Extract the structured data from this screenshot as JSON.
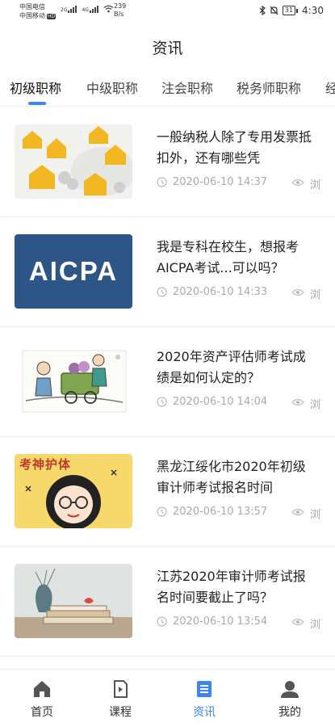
{
  "status_bar": {
    "carrier_1": "中国电信",
    "carrier_2": "中国移动",
    "hd_badge": "HD",
    "net_1": "2G",
    "net_2": "4G",
    "speed_value": "239",
    "speed_unit": "B/s",
    "battery": "31",
    "time": "4:30"
  },
  "header": {
    "title": "资讯"
  },
  "tabs": [
    {
      "label": "初级职称",
      "active": true
    },
    {
      "label": "中级职称"
    },
    {
      "label": "注会职称"
    },
    {
      "label": "税务师职称"
    },
    {
      "label": "经"
    }
  ],
  "articles": [
    {
      "title": "一般纳税人除了专用发票抵扣外，还有哪些凭",
      "time": "2020-06-10 14:37",
      "views": "浏",
      "thumb": "houses-coins"
    },
    {
      "title": "我是专科在校生，想报考AICPA考试...可以吗？",
      "time": "2020-06-10 14:33",
      "views": "浏",
      "thumb": "aicpa-banner",
      "thumb_text": "AICPA"
    },
    {
      "title": "2020年资产评估师考试成绩是如何认定的？",
      "time": "2020-06-10 14:04",
      "views": "浏",
      "thumb": "cartoon-cart"
    },
    {
      "title": "黑龙江绥化市2020年初级审计师考试报名时间",
      "time": "2020-06-10 13:57",
      "views": "浏",
      "thumb": "cartoon-girl",
      "thumb_text": "考神护体"
    },
    {
      "title": "江苏2020年审计师考试报名时间要截止了吗？",
      "time": "2020-06-10 13:54",
      "views": "浏",
      "thumb": "books-vase"
    }
  ],
  "bottom_nav": [
    {
      "label": "首页",
      "icon": "home-icon"
    },
    {
      "label": "课程",
      "icon": "course-icon"
    },
    {
      "label": "资讯",
      "icon": "news-icon",
      "active": true
    },
    {
      "label": "我的",
      "icon": "profile-icon"
    }
  ],
  "colors": {
    "accent": "#3f86f5",
    "meta": "#aaaaaa",
    "aicpa_bg": "#2d5586"
  }
}
